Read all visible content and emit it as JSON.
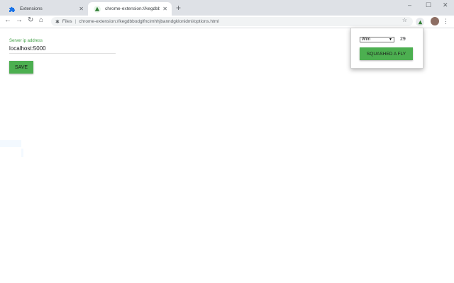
{
  "tabs": [
    {
      "title": "Extensions",
      "active": false
    },
    {
      "title": "chrome-extension://kegdbbodglfn",
      "active": true
    }
  ],
  "toolbar": {
    "scheme_label": "Files",
    "url": "chrome-extension://kegdbbodglfncimhhjbanndgklonidmi/options.html"
  },
  "options": {
    "field_label": "Server ip address",
    "field_value": "localhost:5000",
    "save_label": "SAVE"
  },
  "popup": {
    "select_value": "Wim",
    "count": "29",
    "button_label": "SQUASHED A FLY"
  },
  "colors": {
    "accent_green": "#4caf50",
    "label_green": "#43a047"
  },
  "icons": [
    "extensions-puzzle-icon",
    "extension-triangle-icon",
    "back-icon",
    "forward-icon",
    "reload-icon",
    "home-icon",
    "star-icon",
    "menu-icon"
  ]
}
